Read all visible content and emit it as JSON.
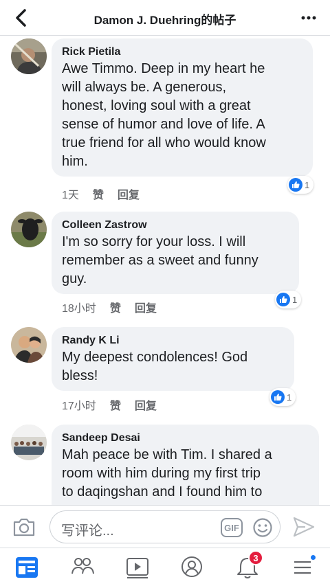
{
  "header": {
    "title": "Damon J. Duehring的帖子",
    "back_icon": "chevron-left-icon",
    "more_icon": "more-horizontal-icon"
  },
  "comments": [
    {
      "author": "Rick Pietila",
      "lines": [
        "Awe Timmo.  Deep in my heart he",
        "will always be. A generous,",
        "honest, loving soul with a great",
        "sense of humor and love of life. A",
        "true friend for all who would know",
        "him."
      ],
      "time": "1天",
      "like_label": "赞",
      "reply_label": "回复",
      "like_count": "1"
    },
    {
      "author": "Colleen Zastrow",
      "lines": [
        "I'm so sorry for your loss. I will",
        "remember as a sweet and funny",
        "guy."
      ],
      "time": "18小时",
      "like_label": "赞",
      "reply_label": "回复",
      "like_count": "1"
    },
    {
      "author": "Randy K Li",
      "lines": [
        "My deepest condolences!  God",
        "bless!"
      ],
      "time": "17小时",
      "like_label": "赞",
      "reply_label": "回复",
      "like_count": "1"
    },
    {
      "author": "Sandeep Desai",
      "lines": [
        "Mah peace be with Tim. I shared a",
        "room with him during my first trip",
        "to daqingshan and I found him to"
      ]
    }
  ],
  "composer": {
    "placeholder": "写评论...",
    "gif_label": "GIF"
  },
  "tabbar": {
    "notification_count": "3"
  },
  "colors": {
    "accent": "#1877f2",
    "bubble": "#f0f2f5",
    "badge": "#e41e3f"
  }
}
